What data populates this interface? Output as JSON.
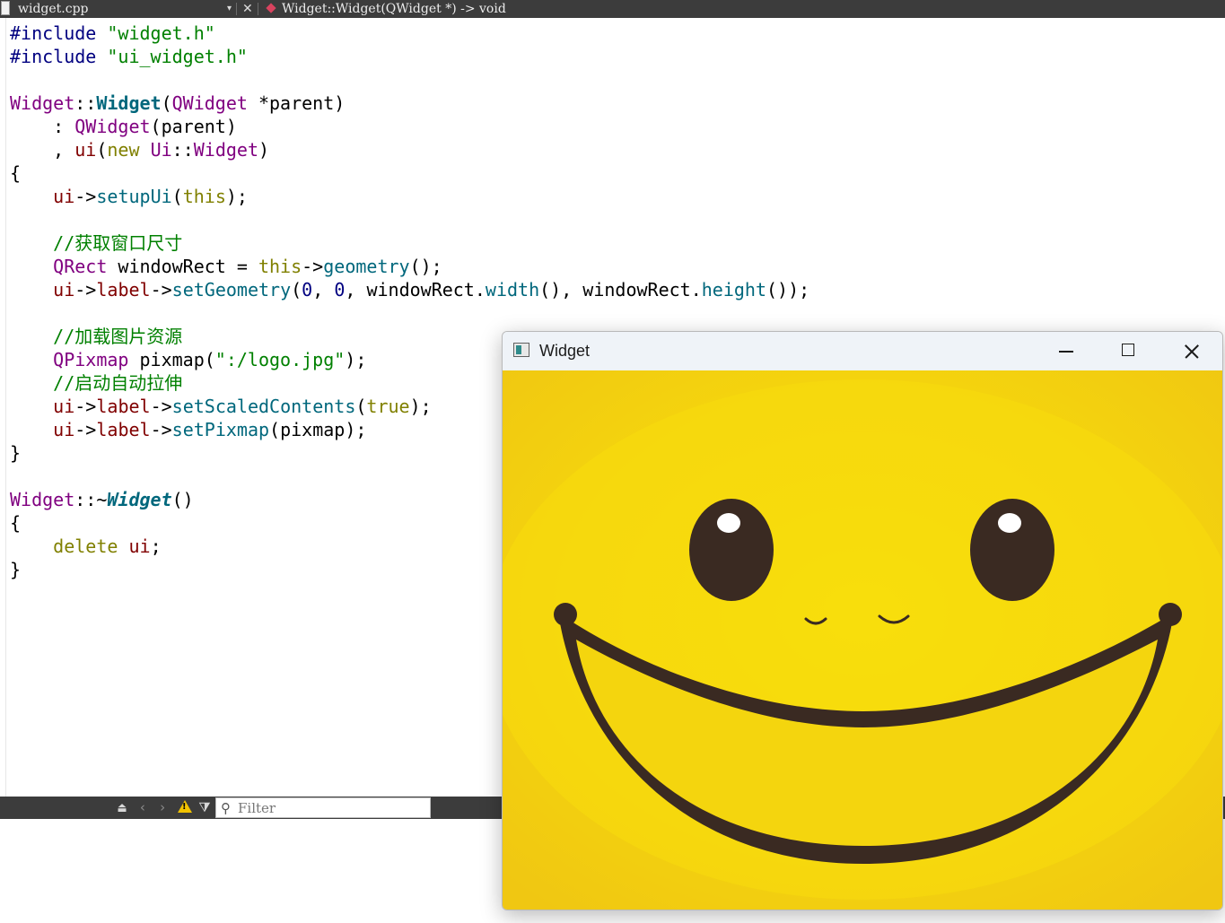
{
  "topbar": {
    "file_name": "widget.cpp",
    "dropdown_glyph": "▾",
    "close_glyph": "✕",
    "symbol": "Widget::Widget(QWidget *) -> void"
  },
  "code_lines": [
    [
      [
        "pp",
        "#include "
      ],
      [
        "str",
        "\"widget.h\""
      ]
    ],
    [
      [
        "pp",
        "#include "
      ],
      [
        "str",
        "\"ui_widget.h\""
      ]
    ],
    [],
    [
      [
        "ty",
        "Widget"
      ],
      [
        "op",
        "::"
      ],
      [
        "fnb",
        "Widget"
      ],
      [
        "op",
        "("
      ],
      [
        "ty",
        "QWidget"
      ],
      [
        "op",
        " *parent)"
      ]
    ],
    [
      [
        "op",
        "    : "
      ],
      [
        "ty",
        "QWidget"
      ],
      [
        "op",
        "(parent)"
      ]
    ],
    [
      [
        "op",
        "    , "
      ],
      [
        "mem",
        "ui"
      ],
      [
        "op",
        "("
      ],
      [
        "kw",
        "new "
      ],
      [
        "ty",
        "Ui"
      ],
      [
        "op",
        "::"
      ],
      [
        "ty",
        "Widget"
      ],
      [
        "op",
        ")"
      ]
    ],
    [
      [
        "op",
        "{"
      ]
    ],
    [
      [
        "op",
        "    "
      ],
      [
        "mem",
        "ui"
      ],
      [
        "op",
        "->"
      ],
      [
        "fn",
        "setupUi"
      ],
      [
        "op",
        "("
      ],
      [
        "kw",
        "this"
      ],
      [
        "op",
        ");"
      ]
    ],
    [],
    [
      [
        "op",
        "    "
      ],
      [
        "cm",
        "//获取窗口尺寸"
      ]
    ],
    [
      [
        "op",
        "    "
      ],
      [
        "ty",
        "QRect"
      ],
      [
        "op",
        " windowRect = "
      ],
      [
        "kw",
        "this"
      ],
      [
        "op",
        "->"
      ],
      [
        "fn",
        "geometry"
      ],
      [
        "op",
        "();"
      ]
    ],
    [
      [
        "op",
        "    "
      ],
      [
        "mem",
        "ui"
      ],
      [
        "op",
        "->"
      ],
      [
        "mem",
        "label"
      ],
      [
        "op",
        "->"
      ],
      [
        "fn",
        "setGeometry"
      ],
      [
        "op",
        "("
      ],
      [
        "num",
        "0"
      ],
      [
        "op",
        ", "
      ],
      [
        "num",
        "0"
      ],
      [
        "op",
        ", windowRect."
      ],
      [
        "fn",
        "width"
      ],
      [
        "op",
        "(), windowRect."
      ],
      [
        "fn",
        "height"
      ],
      [
        "op",
        "());"
      ]
    ],
    [],
    [
      [
        "op",
        "    "
      ],
      [
        "cm",
        "//加载图片资源"
      ]
    ],
    [
      [
        "op",
        "    "
      ],
      [
        "ty",
        "QPixmap"
      ],
      [
        "op",
        " pixmap("
      ],
      [
        "str",
        "\":/logo.jpg\""
      ],
      [
        "op",
        ");"
      ]
    ],
    [
      [
        "op",
        "    "
      ],
      [
        "cm",
        "//启动自动拉伸"
      ]
    ],
    [
      [
        "op",
        "    "
      ],
      [
        "mem",
        "ui"
      ],
      [
        "op",
        "->"
      ],
      [
        "mem",
        "label"
      ],
      [
        "op",
        "->"
      ],
      [
        "fn",
        "setScaledContents"
      ],
      [
        "op",
        "("
      ],
      [
        "kw",
        "true"
      ],
      [
        "op",
        ");"
      ]
    ],
    [
      [
        "op",
        "    "
      ],
      [
        "mem",
        "ui"
      ],
      [
        "op",
        "->"
      ],
      [
        "mem",
        "label"
      ],
      [
        "op",
        "->"
      ],
      [
        "fn",
        "setPixmap"
      ],
      [
        "op",
        "(pixmap);"
      ]
    ],
    [
      [
        "op",
        "}"
      ]
    ],
    [],
    [
      [
        "ty",
        "Widget"
      ],
      [
        "op",
        "::~"
      ],
      [
        "fnbi",
        "Widget"
      ],
      [
        "op",
        "()"
      ]
    ],
    [
      [
        "op",
        "{"
      ]
    ],
    [
      [
        "op",
        "    "
      ],
      [
        "kw",
        "delete "
      ],
      [
        "mem",
        "ui"
      ],
      [
        "op",
        ";"
      ]
    ],
    [
      [
        "op",
        "}"
      ]
    ]
  ],
  "issues": {
    "filter_placeholder": "Filter",
    "filter_value": "",
    "prev_glyph": "‹",
    "next_glyph": "›",
    "warning_glyph": "!",
    "funnel_glyph": "⧩",
    "pin_glyph": "⏏",
    "search_glyph": "⚲"
  },
  "widget_window": {
    "title": "Widget",
    "icons": [
      "app-window-icon",
      "minimize-icon",
      "maximize-icon",
      "close-icon"
    ],
    "image": "smiley-face logo (logo.jpg) scaled to fill label",
    "colors": {
      "face": "#f4d20f",
      "features": "#3a2a22",
      "eye_highlight": "#ffffff"
    }
  }
}
